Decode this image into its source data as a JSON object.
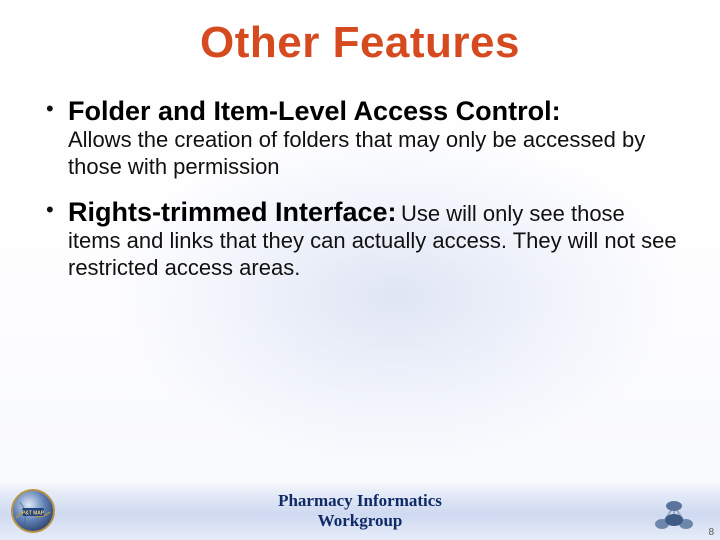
{
  "title": "Other Features",
  "bullets": [
    {
      "heading": "Folder and Item-Level Access Control:",
      "body": "Allows the creation of folders that may only be accessed by those with permission"
    },
    {
      "heading": "Rights-trimmed Interface:",
      "body": "Use will only see those items and links that they can actually access. They will not see restricted access areas."
    }
  ],
  "footer": {
    "line1": "Pharmacy Informatics",
    "line2": "Workgroup"
  },
  "page_number": "8",
  "colors": {
    "title": "#d64a1f",
    "footer_text": "#0f2a66"
  }
}
